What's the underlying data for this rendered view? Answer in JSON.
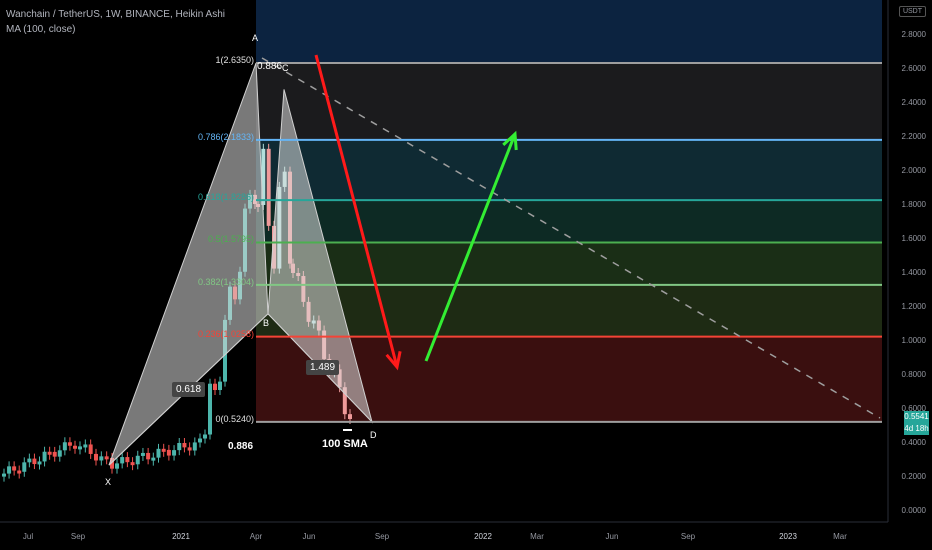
{
  "header": {
    "title": "Wanchain / TetherUS, 1W, BINANCE, Heikin Ashi",
    "indicator": "MA (100, close)"
  },
  "currency_badge": "USDT",
  "price_tags": {
    "last_price": "0.5541",
    "countdown": "4d 18h"
  },
  "chart_data": {
    "type": "candlestick",
    "title": "Wanchain / TetherUS, 1W, BINANCE, Heikin Ashi",
    "indicator": "MA (100, close)",
    "y_ticks": [
      "2.8000",
      "2.6000",
      "2.4000",
      "2.2000",
      "2.0000",
      "1.8000",
      "1.6000",
      "1.4000",
      "1.2000",
      "1.0000",
      "0.8000",
      "0.6000",
      "0.4000",
      "0.2000",
      "0.0000"
    ],
    "ylim": [
      -0.05,
      2.95
    ],
    "x_ticks": [
      "Jul",
      "Sep",
      "2021",
      "Apr",
      "Jun",
      "Sep",
      "2022",
      "Mar",
      "Jun",
      "Sep",
      "2023",
      "Mar"
    ],
    "fib_levels": [
      {
        "ratio": "1",
        "price": 2.635,
        "label": "1(2.6350)",
        "color": "#9e9e9e",
        "zone": "#0c2340"
      },
      {
        "ratio": "0.786",
        "price": 2.1833,
        "label": "0.786(2.1833)",
        "color": "#64b5f6",
        "zone": "#1b1b1d"
      },
      {
        "ratio": "0.618",
        "price": 1.8286,
        "label": "0.618(1.8286)",
        "color": "#26a69a",
        "zone": "#0f2a33"
      },
      {
        "ratio": "0.5",
        "price": 1.5795,
        "label": "0.5(1.5795)",
        "color": "#4caf50",
        "zone": "#0d2a24"
      },
      {
        "ratio": "0.382",
        "price": 1.3304,
        "label": "0.382(1.3304)",
        "color": "#81c784",
        "zone": "#1a2e16"
      },
      {
        "ratio": "0.236",
        "price": 1.0258,
        "label": "0.236(1.0258)",
        "color": "#f44336",
        "zone": "#1e2b14"
      },
      {
        "ratio": "0",
        "price": 0.524,
        "label": "0(0.5240)",
        "color": "#9e9e9e",
        "zone": "#3a0f0f"
      }
    ],
    "pattern_points": [
      {
        "name": "X",
        "price": 0.27
      },
      {
        "name": "A",
        "price": 2.635
      },
      {
        "name": "B",
        "price": 1.16
      },
      {
        "name": "C",
        "price": 2.48
      },
      {
        "name": "D",
        "price": 0.524
      }
    ],
    "pattern_ratios": [
      "0.618",
      "0.886",
      "1.489",
      "0.886"
    ],
    "annotations": [
      "100 SMA"
    ],
    "last_price": 0.5541,
    "grid": false
  }
}
